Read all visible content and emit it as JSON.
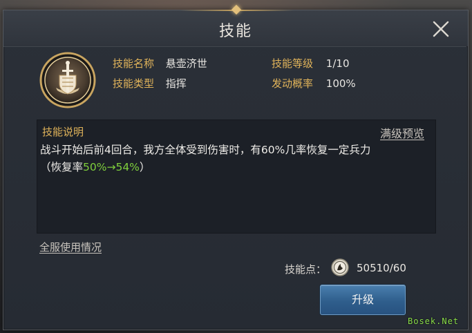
{
  "dialog": {
    "title": "技能"
  },
  "skill": {
    "fields": [
      {
        "label": "技能名称",
        "value": "悬壶济世"
      },
      {
        "label": "技能等级",
        "value": "1/10"
      },
      {
        "label": "技能类型",
        "value": "指挥"
      },
      {
        "label": "发动概率",
        "value": "100%"
      }
    ],
    "icon": "shield-sword-emblem-icon"
  },
  "description": {
    "title": "技能说明",
    "preview_link": "满级预览",
    "line1": "战斗开始后前4回合，我方全体受到伤害时，有60%几率恢复一定兵力",
    "line2_prefix": "（恢复率",
    "line2_highlight": "50%→54%",
    "line2_suffix": "）"
  },
  "usage_link": "全服使用情况",
  "points": {
    "label": "技能点：",
    "value": "50510/60",
    "icon": "skill-point-coin-icon"
  },
  "upgrade_button": "升级",
  "watermark": "Bosek.Net",
  "colors": {
    "label_gold": "#e0b35a",
    "highlight_green": "#7fcf3c",
    "button_blue": "#2f5e8c"
  }
}
